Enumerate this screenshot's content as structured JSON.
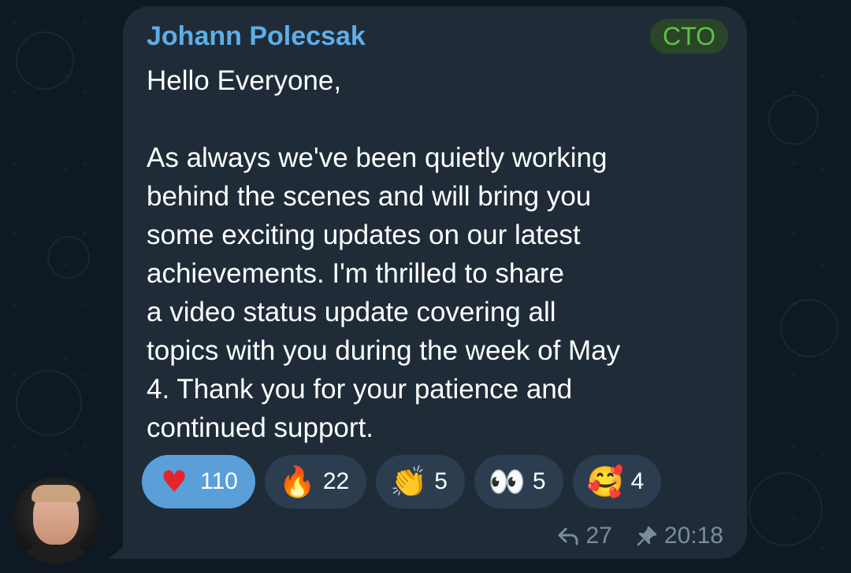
{
  "message": {
    "sender": "Johann Polecsak",
    "role_badge": "CTO",
    "text": "Hello Everyone,\n\nAs always we've been quietly working\nbehind the scenes and will bring you\nsome exciting updates on our latest\nachievements. I'm thrilled to share\na video status update covering all\ntopics with you during the week of May\n4. Thank you for your patience and\ncontinued support.",
    "time": "20:18",
    "replies_count": "27"
  },
  "reactions": [
    {
      "icon": "red-heart",
      "glyph": "♥",
      "count": "110",
      "active": true
    },
    {
      "icon": "fire",
      "glyph": "🔥",
      "count": "22",
      "active": false
    },
    {
      "icon": "clapping-hands",
      "glyph": "👏",
      "count": "5",
      "active": false
    },
    {
      "icon": "eyes",
      "glyph": "👀",
      "count": "5",
      "active": false
    },
    {
      "icon": "smiling-face-with-hearts",
      "glyph": "🥰",
      "count": "4",
      "active": false
    }
  ],
  "colors": {
    "background": "#0f1923",
    "bubble": "#1f2c38",
    "sender_name": "#5eaee8",
    "badge_text": "#5fc04a",
    "reaction_active": "#5a9fd8",
    "reaction_inactive": "#2b3d4f",
    "meta_text": "#7b8c9b"
  }
}
